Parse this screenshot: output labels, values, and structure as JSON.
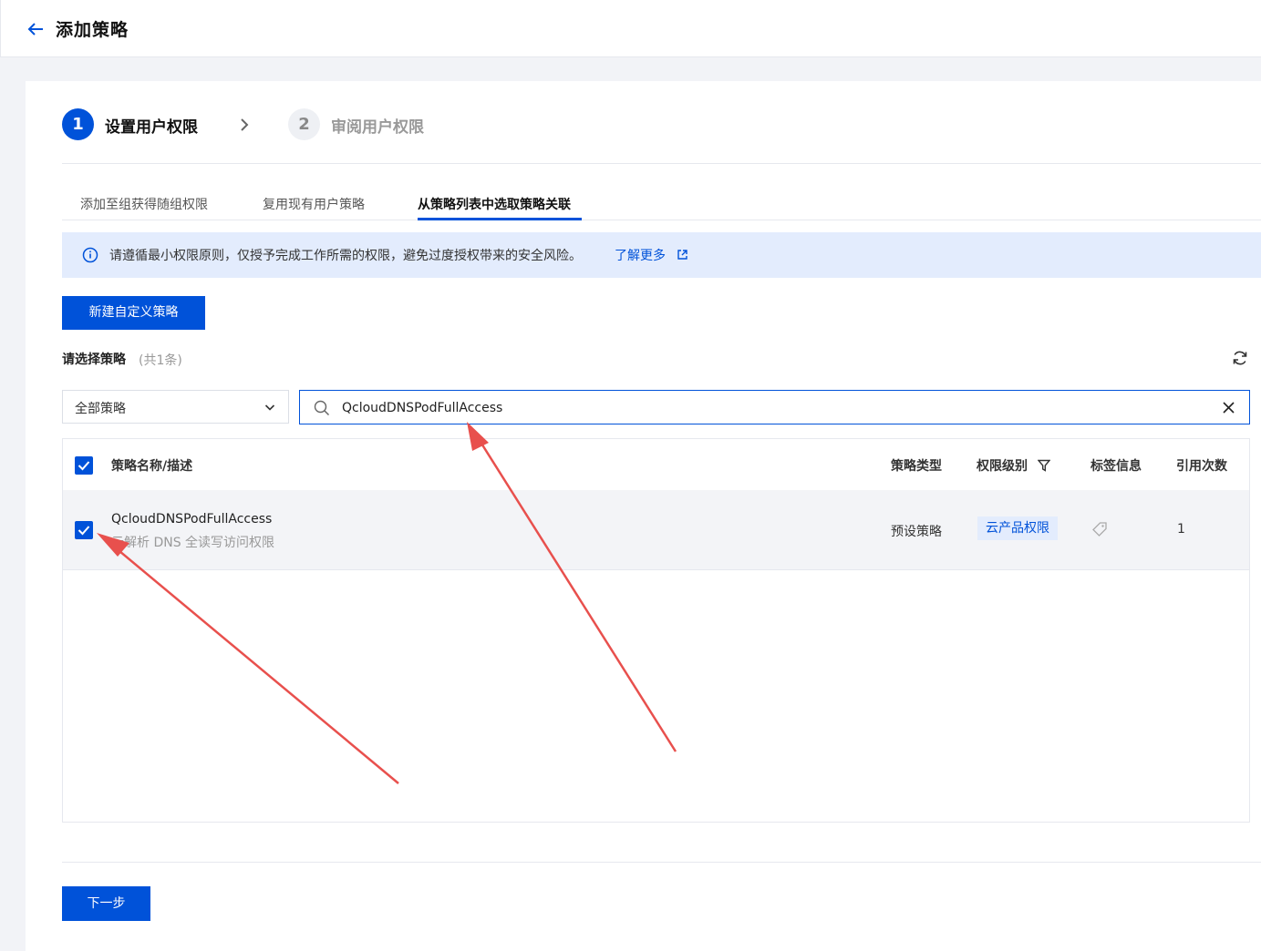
{
  "header": {
    "title": "添加策略"
  },
  "steps": [
    {
      "number": "1",
      "label": "设置用户权限"
    },
    {
      "number": "2",
      "label": "审阅用户权限"
    }
  ],
  "tabs": [
    {
      "label": "添加至组获得随组权限"
    },
    {
      "label": "复用现有用户策略"
    },
    {
      "label": "从策略列表中选取策略关联"
    }
  ],
  "banner": {
    "text": "请遵循最小权限原则，仅授予完成工作所需的权限，避免过度授权带来的安全风险。",
    "link": "了解更多"
  },
  "buttons": {
    "new_policy": "新建自定义策略",
    "next": "下一步"
  },
  "selection": {
    "label": "请选择策略",
    "count": "(共1条)"
  },
  "filter": {
    "dropdown_value": "全部策略"
  },
  "search": {
    "value": "QcloudDNSPodFullAccess"
  },
  "table": {
    "columns": {
      "name": "策略名称/描述",
      "type": "策略类型",
      "level": "权限级别",
      "tags": "标签信息",
      "refs": "引用次数"
    },
    "rows": [
      {
        "name": "QcloudDNSPodFullAccess",
        "description": "云解析 DNS 全读写访问权限",
        "type": "预设策略",
        "level": "云产品权限",
        "refs": "1",
        "checked": true
      }
    ]
  },
  "colors": {
    "primary": "#0052d9",
    "annotation_arrow": "#e8504d"
  }
}
